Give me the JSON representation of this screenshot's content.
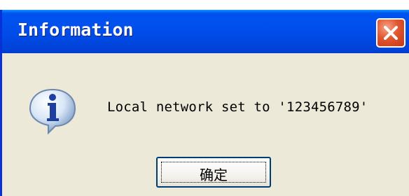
{
  "dialog": {
    "title": "Information",
    "message": "Local network set to '123456789'",
    "icon": "information-icon",
    "ok_label": "确定",
    "close_icon": "close-icon"
  },
  "colors": {
    "titlebar": "#0050ee",
    "body": "#ece9d8",
    "close": "#e0562e"
  }
}
